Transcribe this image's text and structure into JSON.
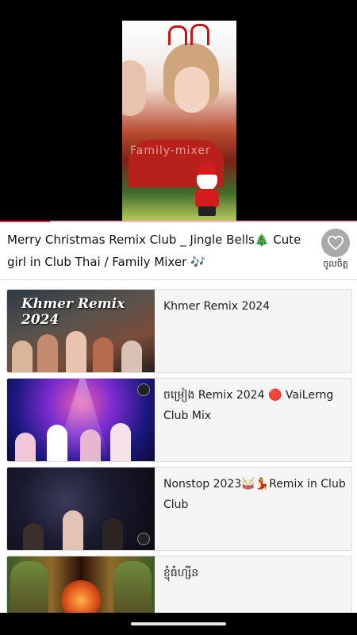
{
  "player": {
    "video_watermark": "Family-mixer",
    "progress_fraction": 0.14
  },
  "now_playing": {
    "title": "Merry Christmas Remix Club _ Jingle Bells🎄 Cute girl in Club Thai / Family Mixer 🎶",
    "favorite_label": "ចូលចិត្ត",
    "favorite_icon": "heart-outline-icon"
  },
  "playlist": [
    {
      "title": "Khmer Remix 2024",
      "thumb_text": "Khmer Remix 2024"
    },
    {
      "title": "ចម្រៀង Remix 2024 🔴 VaiLerng Club Mix",
      "thumb_text": ""
    },
    {
      "title": "Nonstop 2023🥁💃Remix in Club Club",
      "thumb_text": ""
    },
    {
      "title": "ខ្ញុំធំហ្សីន",
      "thumb_text": ""
    }
  ],
  "colors": {
    "progress": "#e0204a",
    "progress_track": "#f3b5c3",
    "favorite_circle": "#a9a9a9"
  }
}
